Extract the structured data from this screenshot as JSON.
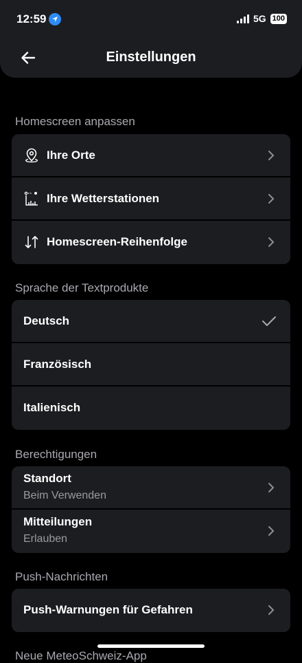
{
  "status_bar": {
    "time": "12:59",
    "network": "5G",
    "battery": "100"
  },
  "header": {
    "title": "Einstellungen"
  },
  "sections": {
    "homescreen": {
      "label": "Homescreen anpassen",
      "items": [
        {
          "label": "Ihre Orte",
          "icon": "location-pin-icon"
        },
        {
          "label": "Ihre Wetterstationen",
          "icon": "weather-station-icon"
        },
        {
          "label": "Homescreen-Reihenfolge",
          "icon": "reorder-icon"
        }
      ]
    },
    "language": {
      "label": "Sprache der Textprodukte",
      "items": [
        {
          "label": "Deutsch",
          "selected": true
        },
        {
          "label": "Französisch"
        },
        {
          "label": "Italienisch"
        }
      ]
    },
    "permissions": {
      "label": "Berechtigungen",
      "items": [
        {
          "label": "Standort",
          "value": "Beim Verwenden"
        },
        {
          "label": "Mitteilungen",
          "value": "Erlauben"
        }
      ]
    },
    "push": {
      "label": "Push-Nachrichten",
      "items": [
        {
          "label": "Push-Warnungen für Gefahren"
        }
      ]
    },
    "partial": {
      "label": "Neue MeteoSchweiz-App"
    }
  }
}
